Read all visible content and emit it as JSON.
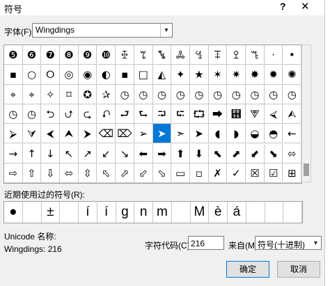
{
  "dialog": {
    "title": "符号",
    "help_label": "?",
    "close_label": "✕"
  },
  "font": {
    "label": "字体(F):",
    "value": "Wingdings"
  },
  "symbols": [
    "❺",
    "❻",
    "❼",
    "❽",
    "❾",
    "❿",
    "ꔀ",
    "ꔂ",
    "ꔄ",
    "ꔆ",
    "ꔈ",
    "ꔊ",
    "ꔌ",
    "ꔎ",
    "·",
    "•",
    "▪",
    "○",
    "⭘",
    "◎",
    "◉",
    "◐",
    "▪",
    "□",
    "◭",
    "✦",
    "★",
    "✶",
    "✷",
    "✸",
    "✹",
    "✺",
    "⌖",
    "⌖",
    "✧",
    "⌑",
    "✪",
    "✰",
    "◷",
    "◷",
    "◷",
    "◷",
    "◷",
    "◷",
    "◷",
    "◷",
    "◷",
    "◷",
    "◷",
    "◷",
    "⮌",
    "⮍",
    "⮎",
    "⮏",
    "⮐",
    "⮑",
    "⮒",
    "⮓",
    "⮔",
    "⮕",
    "⮖",
    "⮗",
    "⮘",
    "⮙",
    "⮚",
    "⮛",
    "⮜",
    "⮝",
    "⮞",
    "⌫",
    "⌦",
    "➢",
    "➤",
    "➣",
    "➤",
    "◖",
    "◗",
    "◒",
    "◓",
    "←",
    "→",
    "↑",
    "↓",
    "↖",
    "↗",
    "↙",
    "↘",
    "⬅",
    "➡",
    "⬆",
    "⬇",
    "⬉",
    "⬈",
    "⬋",
    "⬊",
    "⬄",
    "⇨",
    "⇧",
    "⇩",
    "⬄",
    "⇳",
    "⬁",
    "⬀",
    "⬃",
    "⬂",
    "▭",
    "▫",
    "✗",
    "✓",
    "☒",
    "☑",
    "⊞"
  ],
  "selected_index": 72,
  "recent": {
    "label": "近期使用过的符号(R):",
    "items": [
      "●",
      "",
      "±",
      "",
      "í",
      "í",
      "g",
      "n",
      "m",
      "",
      "M",
      "è",
      "á",
      "",
      "",
      ""
    ]
  },
  "unicode_name": {
    "label": "Unicode 名称:",
    "value": "Wingdings: 216"
  },
  "char_code": {
    "label": "字符代码(C):",
    "value": "216"
  },
  "from": {
    "label": "来自(M):",
    "value": "符号(十进制)"
  },
  "buttons": {
    "ok": "确定",
    "cancel": "取消"
  },
  "colors": {
    "selection": "#0078d7"
  }
}
